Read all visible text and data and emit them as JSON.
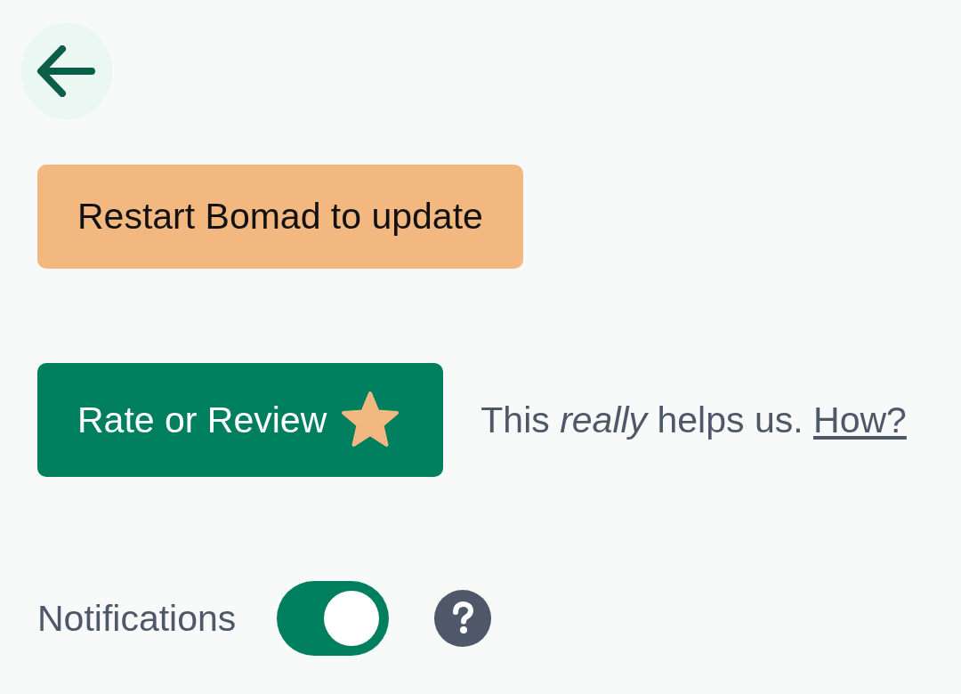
{
  "update_button": {
    "label": "Restart Bomad to update"
  },
  "rate_button": {
    "label": "Rate or Review"
  },
  "rate_note": {
    "text": "This *really* helps us.",
    "link": "How?"
  },
  "notifications": {
    "label": "Notifications",
    "on": true
  }
}
